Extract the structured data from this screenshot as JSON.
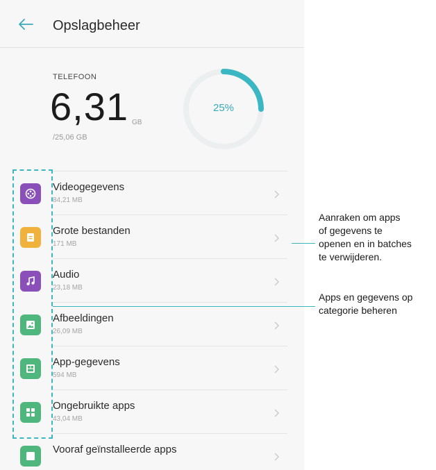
{
  "header": {
    "title": "Opslagbeheer",
    "back_icon": "arrow-left-icon"
  },
  "storage": {
    "label": "TELEFOON",
    "used": "6,31",
    "unit": "GB",
    "total": "/25,06 GB",
    "percent_label": "25%",
    "percent": 25
  },
  "categories": [
    {
      "name": "Videogegevens",
      "size": "84,21 MB",
      "icon": "video-icon",
      "color": "#8a4fb8"
    },
    {
      "name": "Grote bestanden",
      "size": "171 MB",
      "icon": "file-icon",
      "color": "#f0b23c"
    },
    {
      "name": "Audio",
      "size": "23,18 MB",
      "icon": "music-note-icon",
      "color": "#8a4fb8"
    },
    {
      "name": "Afbeeldingen",
      "size": "26,09 MB",
      "icon": "image-icon",
      "color": "#4fb77e"
    },
    {
      "name": "App-gegevens",
      "size": "594 MB",
      "icon": "app-data-icon",
      "color": "#4fb77e"
    },
    {
      "name": "Ongebruikte apps",
      "size": "43,04 MB",
      "icon": "apps-grid-icon",
      "color": "#4fb77e"
    },
    {
      "name": "Vooraf geïnstalleerde apps",
      "size": "",
      "icon": "preinstalled-apps-icon",
      "color": "#4fb77e"
    }
  ],
  "annotations": {
    "open_and_delete": [
      "Aanraken om apps",
      "of gegevens te",
      "openen en in batches",
      "te verwijderen."
    ],
    "by_category": [
      "Apps en gegevens op",
      "categorie beheren"
    ]
  },
  "colors": {
    "accent": "#3bb7c3",
    "ring_track": "#eceff0"
  }
}
